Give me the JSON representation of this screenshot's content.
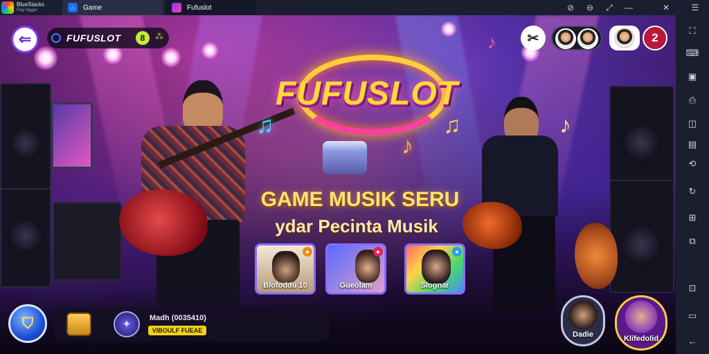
{
  "titlebar": {
    "brand_name": "BlueStacks",
    "brand_sub": "Play bigger",
    "tab_home_label": "Game",
    "tab_home_icon": "home-icon",
    "tab_game_label": "Fufuslot",
    "window_controls": [
      "help-icon",
      "settings-icon",
      "expand-icon",
      "close-icon"
    ]
  },
  "game": {
    "back_icon": "back-arrow-icon",
    "title": "FUFUSLOT",
    "title_badge": "8",
    "tools_icon": "tools-icon",
    "notification_count": "2",
    "logo_text": "FUFUSLOT",
    "headline": "GAME MUSIK SERU",
    "subline": "ydar Pecinta Musik",
    "cards": [
      {
        "label": "Blofoddu 10",
        "badge_color": "#f08a1a"
      },
      {
        "label": "Gueolam",
        "badge_color": "#e0245e"
      },
      {
        "label": "Slognar",
        "badge_color": "#2a9df4"
      }
    ],
    "bottom": {
      "level_text": "Madh (0035410)",
      "level_badge": "VIBOULF FUEAE",
      "left_button_icon": "shield-icon",
      "chest_icon": "treasure-chest-icon",
      "rank_icon": "rank-crystal-icon"
    },
    "avatars": [
      {
        "label": "Dadie"
      },
      {
        "label": "Klifedolid"
      }
    ]
  },
  "sidebar": {
    "icons": [
      "fullscreen-icon",
      "keyboard-icon",
      "gamepad-icon",
      "screenshot-icon",
      "record-icon",
      "media-icon",
      "rotate-icon",
      "sync-icon",
      "folder-icon",
      "macro-icon",
      "pin-icon",
      "multi-instance-icon",
      "back-icon"
    ]
  },
  "colors": {
    "accent": "#7e3cf0",
    "titlebar": "#1b1e2e",
    "logo_gold": "#ffd93a",
    "notif_red": "#b8183a"
  }
}
